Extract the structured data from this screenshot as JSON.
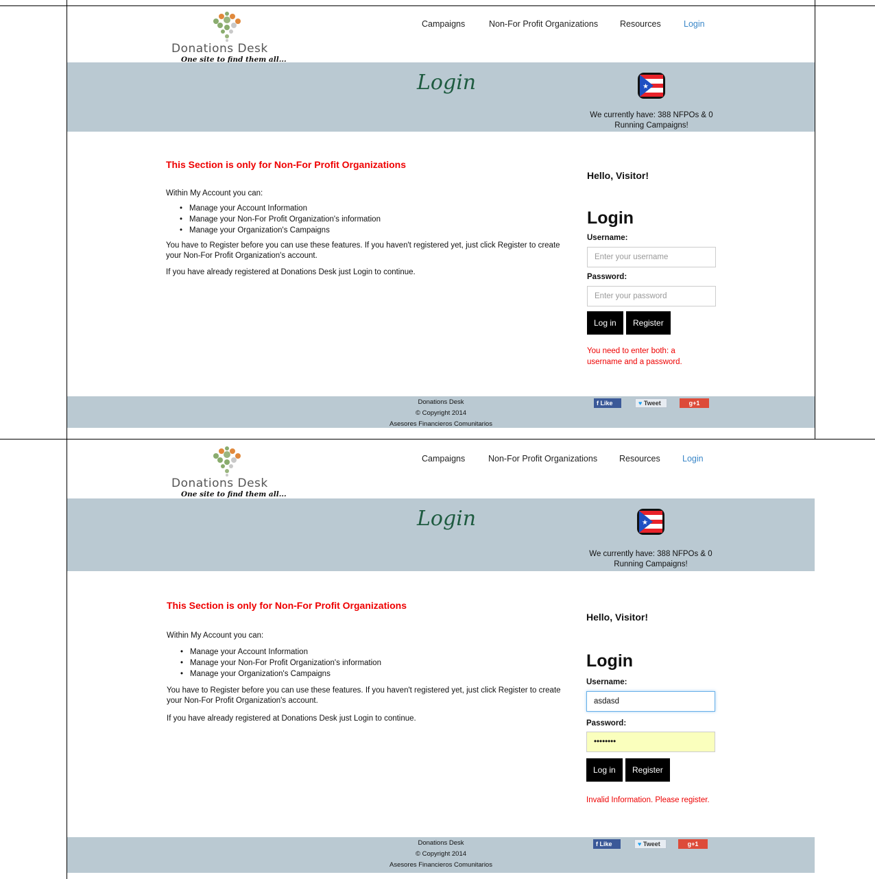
{
  "colors": {
    "band": "#bac9d2",
    "error": "#e00000",
    "nav_active": "#3a87c8",
    "title_green": "#1e5b40",
    "autofill": "#faffbd"
  },
  "logo": {
    "brand": "Donations Desk",
    "tagline": "One site to find them all..."
  },
  "nav": {
    "campaigns": "Campaigns",
    "nfpo": "Non-For Profit Organizations",
    "resources": "Resources",
    "login": "Login"
  },
  "banner": {
    "title": "Login",
    "flag_icon": "puerto-rico-flag-icon",
    "stats": "We currently have: 388 NFPOs & 0 Running Campaigns!"
  },
  "content": {
    "warning": "This Section is only for Non-For Profit Organizations",
    "intro": "Within My Account you can:",
    "features": [
      "Manage your Account Information",
      "Manage your Non-For Profit Organization's information",
      "Manage your Organization's Campaigns"
    ],
    "register_note": "You have to Register before you can use these features.  If you haven't registered yet, just click Register to create your Non-For Profit Organization's account.",
    "login_note": "If you have already registered at Donations Desk just Login to continue."
  },
  "login": {
    "hello": "Hello, Visitor!",
    "heading": "Login",
    "username_label": "Username:",
    "username_placeholder": "Enter your username",
    "password_label": "Password:",
    "password_placeholder": "Enter your password",
    "login_button": "Log in",
    "register_button": "Register"
  },
  "footer": {
    "line1": "Donations Desk",
    "line2": "© Copyright 2014",
    "line3": "Asesores Financieros Comunitarios",
    "like": "Like",
    "tweet": "Tweet",
    "gplus": "g+1"
  },
  "screens": [
    {
      "username_value": "",
      "password_value": "",
      "error": "You need to enter both: a username and a password."
    },
    {
      "username_value": "asdasd",
      "password_value": "••••••••",
      "error": "Invalid Information. Please register."
    }
  ]
}
